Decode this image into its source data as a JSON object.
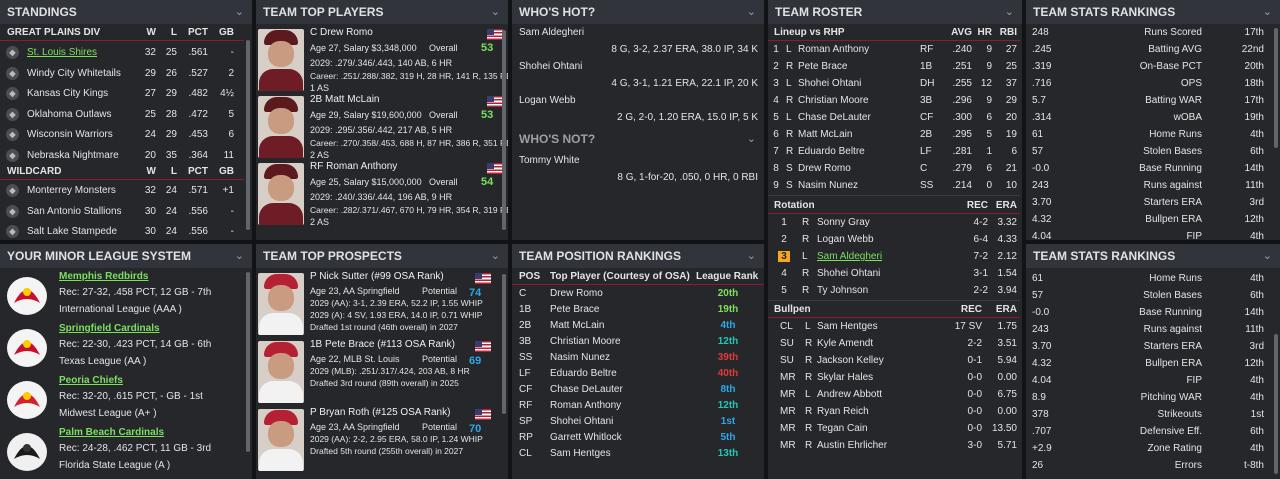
{
  "standings": {
    "title": "STANDINGS",
    "division": "GREAT PLAINS DIV",
    "wildcard": "WILDCARD",
    "cols": [
      "W",
      "L",
      "PCT",
      "GB"
    ],
    "div_rows": [
      {
        "team": "St. Louis Shires",
        "w": "32",
        "l": "25",
        "pct": ".561",
        "gb": "-",
        "logo": "shires-logo"
      },
      {
        "team": "Windy City Whitetails",
        "w": "29",
        "l": "26",
        "pct": ".527",
        "gb": "2",
        "logo": "whitetails-logo"
      },
      {
        "team": "Kansas City Kings",
        "w": "27",
        "l": "29",
        "pct": ".482",
        "gb": "4½",
        "logo": "kings-logo"
      },
      {
        "team": "Oklahoma Outlaws",
        "w": "25",
        "l": "28",
        "pct": ".472",
        "gb": "5",
        "logo": "outlaws-logo"
      },
      {
        "team": "Wisconsin Warriors",
        "w": "24",
        "l": "29",
        "pct": ".453",
        "gb": "6",
        "logo": "warriors-logo"
      },
      {
        "team": "Nebraska Nightmare",
        "w": "20",
        "l": "35",
        "pct": ".364",
        "gb": "11",
        "logo": "nightmare-logo"
      }
    ],
    "wc_rows": [
      {
        "team": "Monterrey Monsters",
        "w": "32",
        "l": "24",
        "pct": ".571",
        "gb": "+1",
        "logo": "monsters-logo"
      },
      {
        "team": "San Antonio Stallions",
        "w": "30",
        "l": "24",
        "pct": ".556",
        "gb": "-",
        "logo": "stallions-logo"
      },
      {
        "team": "Salt Lake Stampede",
        "w": "30",
        "l": "24",
        "pct": ".556",
        "gb": "-",
        "logo": "stampede-logo"
      }
    ]
  },
  "top_players": {
    "title": "TEAM TOP PLAYERS",
    "overall_label": "Overall",
    "players": [
      {
        "name": "C Drew Romo",
        "line1": "Age 27, Salary $3,348,000",
        "overall": "53",
        "line2": "2029: .279/.346/.443, 140 AB, 6 HR",
        "line3": "Career: .251/.288/.382, 319 H, 28 HR, 141 R, 135 RBI",
        "line4": "1 AS"
      },
      {
        "name": "2B Matt McLain",
        "line1": "Age 29, Salary $19,600,000",
        "overall": "53",
        "line2": "2029: .295/.356/.442, 217 AB, 5 HR",
        "line3": "Career: .270/.358/.453, 688 H, 87 HR, 386 R, 351 RBI",
        "line4": "2 AS"
      },
      {
        "name": "RF Roman Anthony",
        "line1": "Age 25, Salary $15,000,000",
        "overall": "54",
        "line2": "2029: .240/.336/.444, 196 AB, 9 HR",
        "line3": "Career: .282/.371/.467, 670 H, 79 HR, 354 R, 319 RBI",
        "line4": "2 AS"
      }
    ]
  },
  "whos_hot": {
    "title": "WHO'S HOT?",
    "players": [
      {
        "name": "Sam Aldegheri",
        "stats": "8 G, 3-2, 2.37 ERA, 38.0 IP, 34 K"
      },
      {
        "name": "Shohei Ohtani",
        "stats": "4 G, 3-1, 1.21 ERA, 22.1 IP, 20 K"
      },
      {
        "name": "Logan Webb",
        "stats": "2 G, 2-0, 1.20 ERA, 15.0 IP, 5 K"
      }
    ]
  },
  "whos_not": {
    "title": "WHO'S NOT?",
    "players": [
      {
        "name": "Tommy White",
        "stats": "8 G, 1-for-20, .050, 0 HR, 0 RBI"
      }
    ]
  },
  "roster": {
    "title": "TEAM ROSTER",
    "lineup_label": "Lineup vs RHP",
    "lineup_cols": [
      "AVG",
      "HR",
      "RBI"
    ],
    "lineup": [
      {
        "n": "1",
        "h": "L",
        "name": "Roman Anthony",
        "pos": "RF",
        "avg": ".240",
        "hr": "9",
        "rbi": "27"
      },
      {
        "n": "2",
        "h": "R",
        "name": "Pete Brace",
        "pos": "1B",
        "avg": ".251",
        "hr": "9",
        "rbi": "25"
      },
      {
        "n": "3",
        "h": "L",
        "name": "Shohei Ohtani",
        "pos": "DH",
        "avg": ".255",
        "hr": "12",
        "rbi": "37"
      },
      {
        "n": "4",
        "h": "R",
        "name": "Christian Moore",
        "pos": "3B",
        "avg": ".296",
        "hr": "9",
        "rbi": "29"
      },
      {
        "n": "5",
        "h": "L",
        "name": "Chase DeLauter",
        "pos": "CF",
        "avg": ".300",
        "hr": "6",
        "rbi": "20"
      },
      {
        "n": "6",
        "h": "R",
        "name": "Matt McLain",
        "pos": "2B",
        "avg": ".295",
        "hr": "5",
        "rbi": "19"
      },
      {
        "n": "7",
        "h": "R",
        "name": "Eduardo Beltre",
        "pos": "LF",
        "avg": ".281",
        "hr": "1",
        "rbi": "6"
      },
      {
        "n": "8",
        "h": "S",
        "name": "Drew Romo",
        "pos": "C",
        "avg": ".279",
        "hr": "6",
        "rbi": "21"
      },
      {
        "n": "9",
        "h": "S",
        "name": "Nasim Nunez",
        "pos": "SS",
        "avg": ".214",
        "hr": "0",
        "rbi": "10"
      }
    ],
    "rotation_label": "Rotation",
    "rotation_cols": [
      "REC",
      "ERA"
    ],
    "rotation": [
      {
        "n": "1",
        "h": "R",
        "name": "Sonny Gray",
        "rec": "4-2",
        "era": "3.32"
      },
      {
        "n": "2",
        "h": "R",
        "name": "Logan Webb",
        "rec": "6-4",
        "era": "4.33"
      },
      {
        "n": "3",
        "h": "L",
        "name": "Sam Aldegheri",
        "rec": "7-2",
        "era": "2.12"
      },
      {
        "n": "4",
        "h": "R",
        "name": "Shohei Ohtani",
        "rec": "3-1",
        "era": "1.54"
      },
      {
        "n": "5",
        "h": "R",
        "name": "Ty Johnson",
        "rec": "2-2",
        "era": "3.94"
      }
    ],
    "bullpen_label": "Bullpen",
    "bullpen_cols": [
      "REC",
      "ERA"
    ],
    "bullpen": [
      {
        "role": "CL",
        "h": "L",
        "name": "Sam Hentges",
        "rec": "17 SV",
        "era": "1.75"
      },
      {
        "role": "SU",
        "h": "R",
        "name": "Kyle Amendt",
        "rec": "2-2",
        "era": "3.51"
      },
      {
        "role": "SU",
        "h": "R",
        "name": "Jackson Kelley",
        "rec": "0-1",
        "era": "5.94"
      },
      {
        "role": "MR",
        "h": "R",
        "name": "Skylar Hales",
        "rec": "0-0",
        "era": "0.00"
      },
      {
        "role": "MR",
        "h": "L",
        "name": "Andrew Abbott",
        "rec": "0-0",
        "era": "6.75"
      },
      {
        "role": "MR",
        "h": "R",
        "name": "Ryan Reich",
        "rec": "0-0",
        "era": "0.00"
      },
      {
        "role": "MR",
        "h": "R",
        "name": "Tegan Cain",
        "rec": "0-0",
        "era": "13.50"
      },
      {
        "role": "MR",
        "h": "R",
        "name": "Austin Ehrlicher",
        "rec": "3-0",
        "era": "5.71"
      }
    ]
  },
  "stats_top": {
    "title": "TEAM STATS RANKINGS",
    "rows": [
      {
        "v": "248",
        "s": "Runs Scored",
        "r": "17th"
      },
      {
        "v": ".245",
        "s": "Batting AVG",
        "r": "22nd"
      },
      {
        "v": ".319",
        "s": "On-Base PCT",
        "r": "20th"
      },
      {
        "v": ".716",
        "s": "OPS",
        "r": "18th"
      },
      {
        "v": "5.7",
        "s": "Batting WAR",
        "r": "17th"
      },
      {
        "v": ".314",
        "s": "wOBA",
        "r": "19th"
      },
      {
        "v": "61",
        "s": "Home Runs",
        "r": "4th"
      },
      {
        "v": "57",
        "s": "Stolen Bases",
        "r": "6th"
      },
      {
        "v": "-0.0",
        "s": "Base Running",
        "r": "14th"
      },
      {
        "v": "243",
        "s": "Runs against",
        "r": "11th"
      },
      {
        "v": "3.70",
        "s": "Starters ERA",
        "r": "3rd"
      },
      {
        "v": "4.32",
        "s": "Bullpen ERA",
        "r": "12th"
      },
      {
        "v": "4.04",
        "s": "FIP",
        "r": "4th"
      }
    ]
  },
  "minor": {
    "title": "YOUR MINOR LEAGUE SYSTEM",
    "teams": [
      {
        "name": "Memphis Redbirds",
        "rec": "Rec: 27-32, .458 PCT, 12 GB - 7th",
        "league": "International League (AAA )",
        "logo": "redbirds-logo"
      },
      {
        "name": "Springfield Cardinals",
        "rec": "Rec: 22-30, .423 PCT, 14 GB - 6th",
        "league": "Texas League (AA )",
        "logo": "springfield-logo"
      },
      {
        "name": "Peoria Chiefs",
        "rec": "Rec: 32-20, .615 PCT, - GB - 1st",
        "league": "Midwest League (A+ )",
        "logo": "peoria-logo"
      },
      {
        "name": "Palm Beach Cardinals",
        "rec": "Rec: 24-28, .462 PCT, 11 GB - 3rd",
        "league": "Florida State League (A )",
        "logo": "palmbeach-logo"
      }
    ]
  },
  "prospects": {
    "title": "TEAM TOP PROSPECTS",
    "potential_label": "Potential",
    "players": [
      {
        "name": "P Nick Sutter (#99 OSA Rank)",
        "line1": "Age 23, AA Springfield",
        "pot": "74",
        "line2": "2029 (AA): 3-1, 2.39 ERA, 52.2 IP, 1.55 WHIP",
        "line3": "2029 (A): 4 SV, 1.93 ERA, 14.0 IP, 0.71 WHIP",
        "line4": "Drafted 1st round (46th overall) in 2027"
      },
      {
        "name": "1B Pete Brace (#113 OSA Rank)",
        "line1": "Age 22, MLB St. Louis",
        "pot": "69",
        "line2": "2029 (MLB): .251/.317/.424, 203 AB, 8 HR",
        "line3": "Drafted 3rd round (89th overall) in 2025",
        "line4": ""
      },
      {
        "name": "P Bryan Roth (#125 OSA Rank)",
        "line1": "Age 23, AA Springfield",
        "pot": "70",
        "line2": "2029 (AA): 2-2, 2.95 ERA, 58.0 IP, 1.24 WHIP",
        "line3": "Drafted 5th round (255th overall) in 2027",
        "line4": ""
      }
    ]
  },
  "positions": {
    "title": "TEAM POSITION RANKINGS",
    "cols": [
      "POS",
      "Top Player (Courtesy of OSA)",
      "League Rank"
    ],
    "rows": [
      {
        "pos": "C",
        "player": "Drew Romo",
        "rank": "20th",
        "color": "#7be05d"
      },
      {
        "pos": "1B",
        "player": "Pete Brace",
        "rank": "19th",
        "color": "#7be05d"
      },
      {
        "pos": "2B",
        "player": "Matt McLain",
        "rank": "4th",
        "color": "#2fa7e8"
      },
      {
        "pos": "3B",
        "player": "Christian Moore",
        "rank": "12th",
        "color": "#22c7b6"
      },
      {
        "pos": "SS",
        "player": "Nasim Nunez",
        "rank": "39th",
        "color": "#e03a3a"
      },
      {
        "pos": "LF",
        "player": "Eduardo Beltre",
        "rank": "40th",
        "color": "#e03a3a"
      },
      {
        "pos": "CF",
        "player": "Chase DeLauter",
        "rank": "8th",
        "color": "#2fa7e8"
      },
      {
        "pos": "RF",
        "player": "Roman Anthony",
        "rank": "12th",
        "color": "#22c7b6"
      },
      {
        "pos": "SP",
        "player": "Shohei Ohtani",
        "rank": "1st",
        "color": "#2fa7e8"
      },
      {
        "pos": "RP",
        "player": "Garrett Whitlock",
        "rank": "5th",
        "color": "#2fa7e8"
      },
      {
        "pos": "CL",
        "player": "Sam Hentges",
        "rank": "13th",
        "color": "#22c7b6"
      }
    ]
  },
  "stats_bottom": {
    "title": "TEAM STATS RANKINGS",
    "rows": [
      {
        "v": "61",
        "s": "Home Runs",
        "r": "4th"
      },
      {
        "v": "57",
        "s": "Stolen Bases",
        "r": "6th"
      },
      {
        "v": "-0.0",
        "s": "Base Running",
        "r": "14th"
      },
      {
        "v": "243",
        "s": "Runs against",
        "r": "11th"
      },
      {
        "v": "3.70",
        "s": "Starters ERA",
        "r": "3rd"
      },
      {
        "v": "4.32",
        "s": "Bullpen ERA",
        "r": "12th"
      },
      {
        "v": "4.04",
        "s": "FIP",
        "r": "4th"
      },
      {
        "v": "8.9",
        "s": "Pitching WAR",
        "r": "4th"
      },
      {
        "v": "378",
        "s": "Strikeouts",
        "r": "1st"
      },
      {
        "v": ".707",
        "s": "Defensive Eff.",
        "r": "6th"
      },
      {
        "v": "+2.9",
        "s": "Zone Rating",
        "r": "4th"
      },
      {
        "v": "26",
        "s": "Errors",
        "r": "t-8th"
      }
    ]
  }
}
